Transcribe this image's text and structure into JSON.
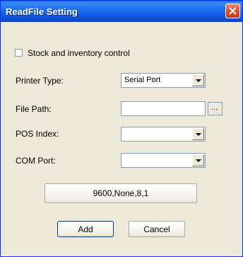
{
  "window": {
    "title": "ReadFile Setting"
  },
  "form": {
    "stock_checkbox_label": "Stock and inventory control",
    "stock_checked": false,
    "printer_type_label": "Printer Type:",
    "printer_type_value": "Serial Port",
    "file_path_label": "File Path:",
    "file_path_value": "",
    "browse_label": "...",
    "pos_index_label": "POS Index:",
    "pos_index_value": "",
    "com_port_label": "COM Port:",
    "com_port_value": "",
    "serial_settings_label": "9600,None,8,1"
  },
  "actions": {
    "add_label": "Add",
    "cancel_label": "Cancel"
  },
  "colors": {
    "title_bar": "#0a5fe6",
    "close_button": "#d24a2c",
    "dialog_bg": "#ece9d8"
  }
}
